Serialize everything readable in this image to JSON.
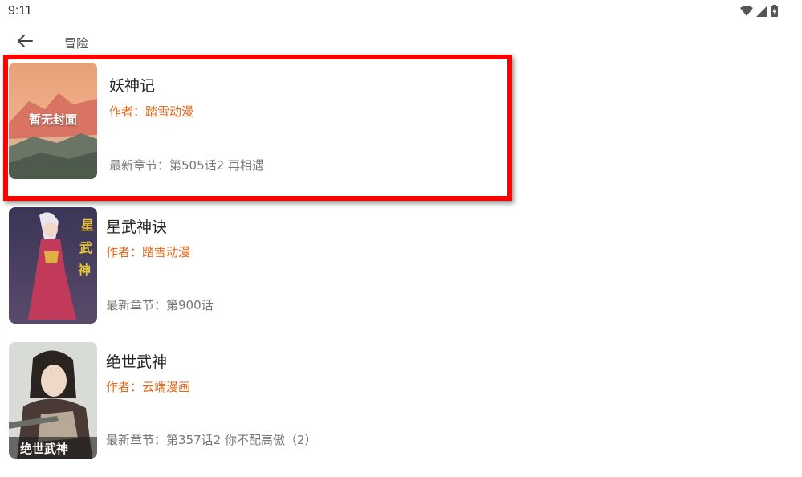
{
  "status_bar": {
    "time": "9:11",
    "icons": [
      "wifi-icon",
      "cellular-signal-icon",
      "battery-icon"
    ]
  },
  "toolbar": {
    "back_icon": "arrow-left-icon",
    "title": "冒险"
  },
  "colors": {
    "author": "#e0691c",
    "chapter": "#777777",
    "highlight": "#ff0000"
  },
  "comics": [
    {
      "title": "妖神记",
      "author": "作者：踏雪动漫",
      "latest_chapter": "最新章节：第505话2 再相遇",
      "cover_placeholder": "暂无封面",
      "highlighted": true
    },
    {
      "title": "星武神诀",
      "author": "作者：踏雪动漫",
      "latest_chapter": "最新章节：第900话",
      "cover_placeholder": "",
      "highlighted": false
    },
    {
      "title": "绝世武神",
      "author": "作者：云端漫画",
      "latest_chapter": "最新章节：第357话2 你不配高傲（2）",
      "cover_placeholder": "",
      "highlighted": false
    }
  ]
}
